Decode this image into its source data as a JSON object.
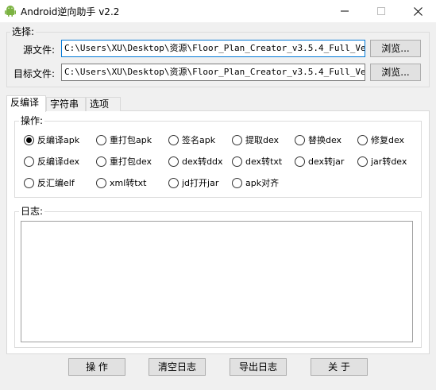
{
  "window": {
    "title": "Android逆向助手 v2.2",
    "min_glyph": "—",
    "max_glyph": "☐",
    "close_glyph": "✕"
  },
  "select_group": {
    "legend": "选择:",
    "source_label": "源文件:",
    "source_value": "C:\\Users\\XU\\Desktop\\资源\\Floor_Plan_Creator_v3.5.4_Full_Version",
    "target_label": "目标文件:",
    "target_value": "C:\\Users\\XU\\Desktop\\资源\\Floor_Plan_Creator_v3.5.4_Full_Version",
    "browse_label": "浏览..."
  },
  "tabs": [
    "反编译",
    "字符串",
    "选项"
  ],
  "operations": {
    "legend": "操作:",
    "selected": "反编译apk",
    "options": [
      "反编译apk",
      "重打包apk",
      "签名apk",
      "提取dex",
      "替换dex",
      "修复dex",
      "反编译dex",
      "重打包dex",
      "dex转ddx",
      "dex转txt",
      "dex转jar",
      "jar转dex",
      "反汇编elf",
      "xml转txt",
      "jd打开jar",
      "apk对齐"
    ]
  },
  "log": {
    "legend": "日志:",
    "content": ""
  },
  "buttons": {
    "operate": "操 作",
    "clear_log": "清空日志",
    "export_log": "导出日志",
    "close": "关 于"
  },
  "colors": {
    "focus_border": "#0078d7",
    "android_green": "#7cb342"
  }
}
